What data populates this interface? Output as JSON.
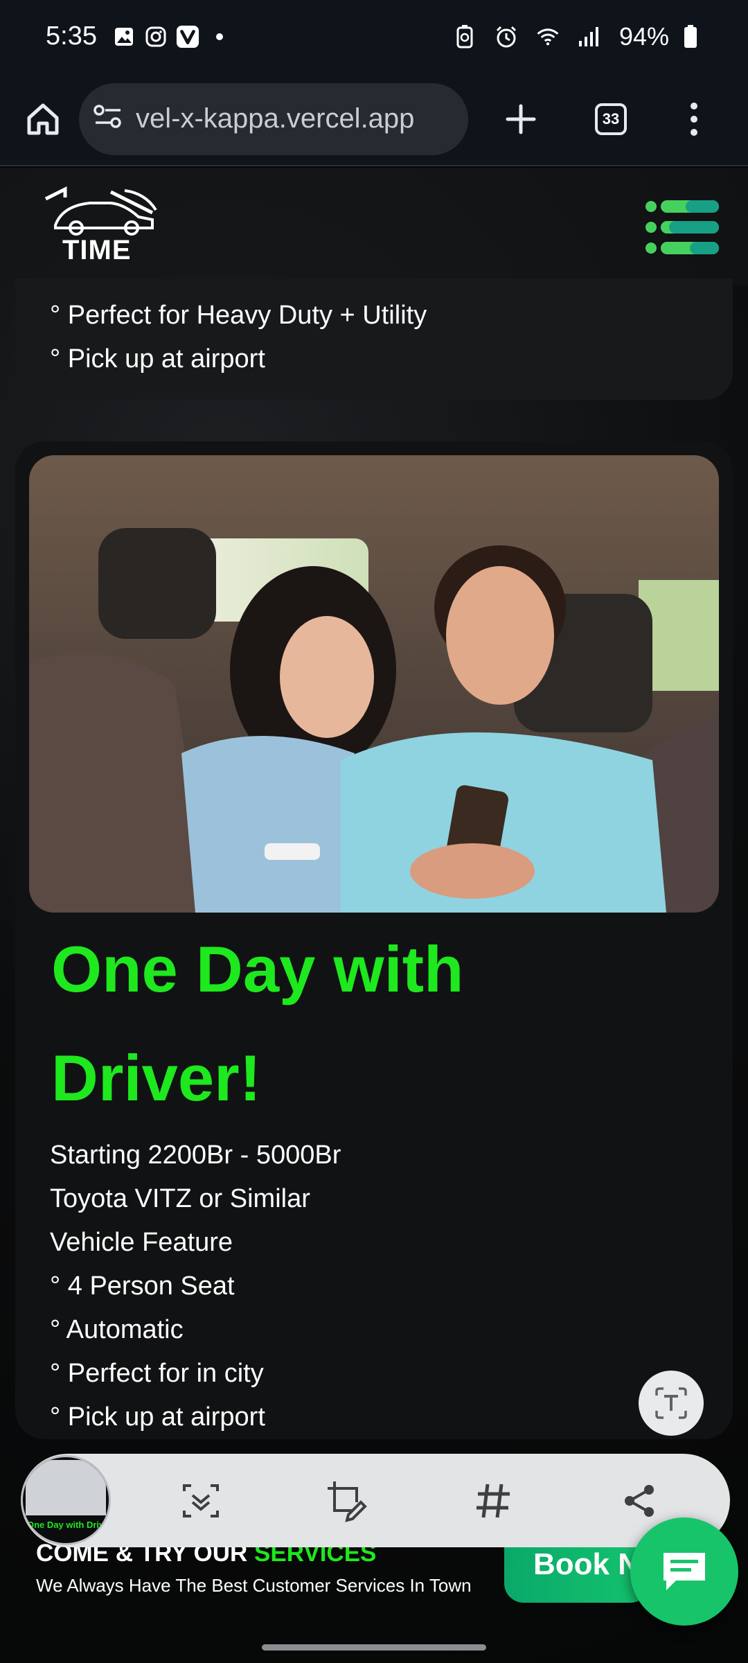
{
  "status_bar": {
    "time": "5:35",
    "battery": "94%"
  },
  "browser": {
    "url": "vel-x-kappa.vercel.app",
    "tab_count": "33"
  },
  "site": {
    "logo_text": "TIME",
    "accent_color": "#1ee81e"
  },
  "previous_card": {
    "features": [
      "° Perfect for Heavy Duty + Utility",
      "° Pick up at airport"
    ]
  },
  "main_card": {
    "title_line1": "One Day with",
    "title_line2": "Driver!",
    "details": [
      "Starting 2200Br - 5000Br",
      "Toyota VITZ or Similar",
      "Vehicle Feature",
      "° 4 Person Seat",
      "° Automatic",
      "° Perfect for in city",
      "° Pick up at airport"
    ]
  },
  "screenshot_toolbar": {
    "thumb_label": "One Day with Driver"
  },
  "footer": {
    "heading_prefix": "COME & TRY OUR",
    "heading_highlight": "SERVICES",
    "subtext": "We Always Have The Best Customer Services In Town",
    "book_button": "Book Now"
  }
}
